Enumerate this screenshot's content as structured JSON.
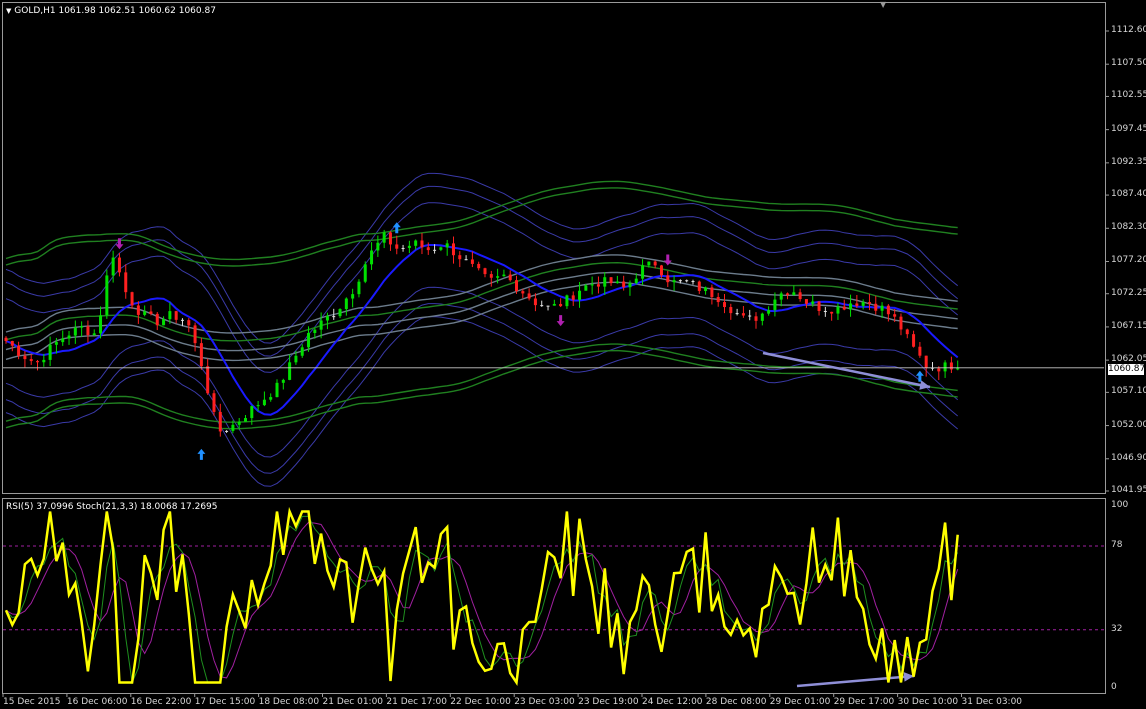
{
  "header": {
    "symbol_title": "GOLD,H1  1061.98 1062.51 1060.62 1060.87"
  },
  "indicator_header": {
    "title": "RSI(5) 37.0996  Stoch(21,3,3) 18.0068 17.2695"
  },
  "current_price": "1060.87",
  "price_axis": {
    "labels": [
      "1112.60",
      "1107.50",
      "1102.55",
      "1097.45",
      "1092.35",
      "1087.40",
      "1082.30",
      "1077.20",
      "1072.25",
      "1067.15",
      "1062.05",
      "1057.10",
      "1052.00",
      "1046.90",
      "1041.95"
    ],
    "range": [
      1041.95,
      1112.6
    ]
  },
  "indicator_axis": {
    "labels": [
      "100",
      "78",
      "32",
      "0"
    ],
    "levels": [
      100,
      78,
      32,
      0
    ]
  },
  "time_axis": {
    "labels": [
      "15 Dec 2015",
      "16 Dec 06:00",
      "16 Dec 22:00",
      "17 Dec 15:00",
      "18 Dec 08:00",
      "21 Dec 01:00",
      "21 Dec 17:00",
      "22 Dec 10:00",
      "23 Dec 03:00",
      "23 Dec 19:00",
      "24 Dec 12:00",
      "28 Dec 08:00",
      "29 Dec 01:00",
      "29 Dec 17:00",
      "30 Dec 10:00",
      "31 Dec 03:00"
    ]
  },
  "colors": {
    "background": "#000000",
    "bull_candle": "#00e000",
    "bear_candle": "#ff2020",
    "doji": "#e0e0e0",
    "ma_blue": "#1a1aff",
    "band_green": "#208020",
    "band_slate": "#6c7c8c",
    "envelope_thin": "#3a3aa8",
    "rsi_line": "#ffff00",
    "stoch_main": "#1e8f1e",
    "stoch_signal": "#a020a0",
    "level_line": "#a020a0",
    "divergence_arrow": "#8f8fd8",
    "buy_arrow": "#2090ff",
    "sell_arrow": "#b020b0"
  },
  "chart_data": {
    "type": "candlestick",
    "title": "GOLD,H1",
    "icons": [
      "buy-arrow-icon",
      "sell-arrow-icon",
      "divergence-arrow-icon"
    ],
    "approximate_closes": [
      1065,
      1063,
      1061.5,
      1064,
      1066,
      1067,
      1066,
      1079,
      1072,
      1069,
      1068,
      1069,
      1068,
      1061,
      1051,
      1052,
      1054,
      1056,
      1058,
      1062,
      1066,
      1068,
      1070,
      1073,
      1078,
      1081,
      1079,
      1080,
      1079,
      1080,
      1078,
      1076,
      1074,
      1075,
      1073,
      1071,
      1070,
      1071,
      1073,
      1074,
      1074,
      1073,
      1076,
      1077,
      1074,
      1074,
      1073,
      1072,
      1070,
      1068,
      1069,
      1072,
      1073,
      1071,
      1070,
      1070,
      1071,
      1071,
      1070,
      1068,
      1064,
      1061,
      1061,
      1061.5
    ]
  }
}
